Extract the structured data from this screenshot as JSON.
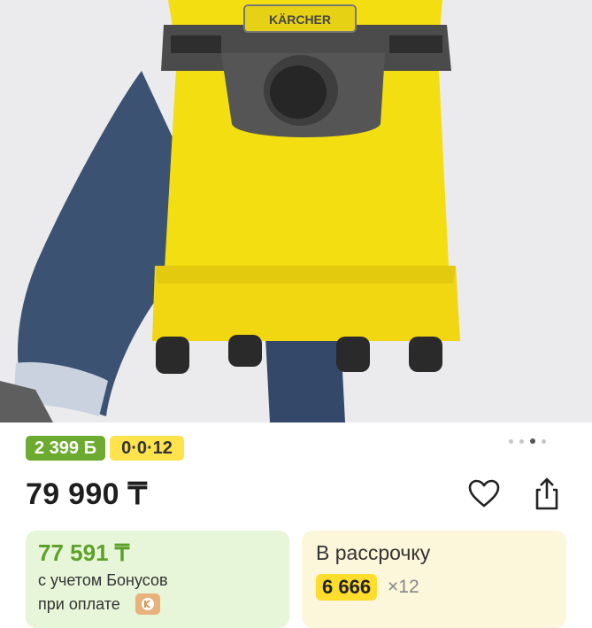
{
  "product": {
    "image_alt": "Karcher wet and dry vacuum cleaner carried by a person",
    "brand_mark": "KÄRCHER"
  },
  "badges": {
    "bonus": "2 399 Б",
    "installment": "0·0·12"
  },
  "carousel": {
    "total": 4,
    "active": 3
  },
  "price": {
    "main": "79 990 ₸"
  },
  "actions": {
    "favorite_icon": "heart-icon",
    "share_icon": "share-icon"
  },
  "bonus_card": {
    "price": "77 591 ₸",
    "line1": "с учетом Бонусов",
    "line2": "при оплате"
  },
  "installment_card": {
    "title": "В рассрочку",
    "amount": "6 666",
    "months": "×12"
  },
  "colors": {
    "bonus_green": "#6cab2f",
    "installment_yellow": "#ffe34d",
    "product_yellow": "#f7e21a"
  }
}
